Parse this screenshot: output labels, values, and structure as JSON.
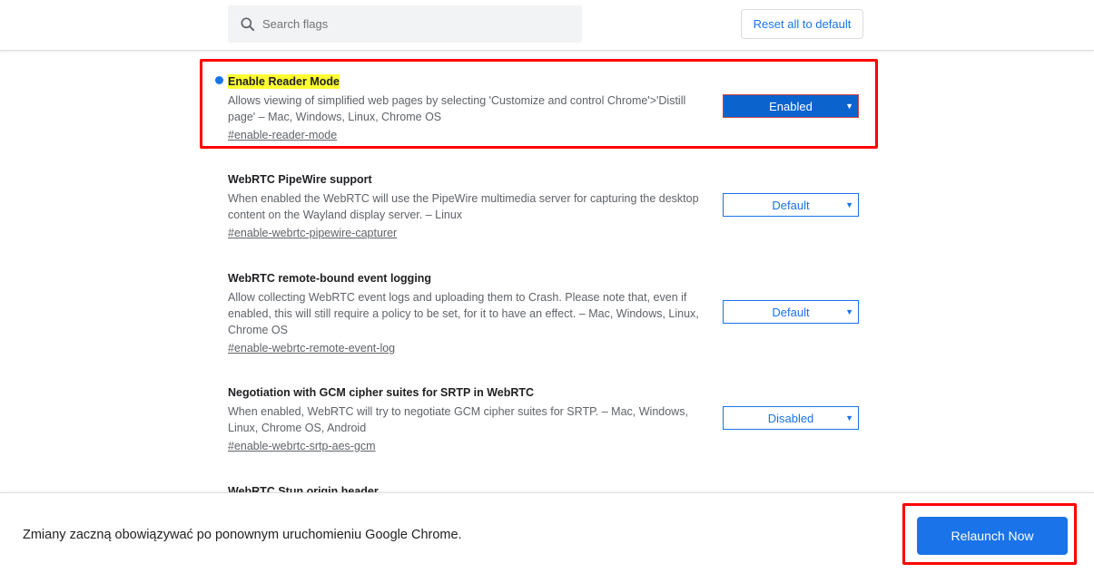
{
  "header": {
    "search_placeholder": "Search flags",
    "reset_label": "Reset all to default"
  },
  "flags": [
    {
      "title": "Enable Reader Mode",
      "desc": "Allows viewing of simplified web pages by selecting 'Customize and control Chrome'>'Distill page' – Mac, Windows, Linux, Chrome OS",
      "link": "#enable-reader-mode",
      "value": "Enabled",
      "highlighted": true
    },
    {
      "title": "WebRTC PipeWire support",
      "desc": "When enabled the WebRTC will use the PipeWire multimedia server for capturing the desktop content on the Wayland display server. – Linux",
      "link": "#enable-webrtc-pipewire-capturer",
      "value": "Default"
    },
    {
      "title": "WebRTC remote-bound event logging",
      "desc": "Allow collecting WebRTC event logs and uploading them to Crash. Please note that, even if enabled, this will still require a policy to be set, for it to have an effect. – Mac, Windows, Linux, Chrome OS",
      "link": "#enable-webrtc-remote-event-log",
      "value": "Default"
    },
    {
      "title": "Negotiation with GCM cipher suites for SRTP in WebRTC",
      "desc": "When enabled, WebRTC will try to negotiate GCM cipher suites for SRTP. – Mac, Windows, Linux, Chrome OS, Android",
      "link": "#enable-webrtc-srtp-aes-gcm",
      "value": "Disabled"
    },
    {
      "title": "WebRTC Stun origin header"
    }
  ],
  "footer": {
    "message": "Zmiany zaczną obowiązywać po ponownym uruchomieniu Google Chrome.",
    "relaunch_label": "Relaunch Now"
  },
  "colors": {
    "accent": "#1a73e8",
    "highlight": "#ffff33",
    "annotation": "#ff0000"
  }
}
